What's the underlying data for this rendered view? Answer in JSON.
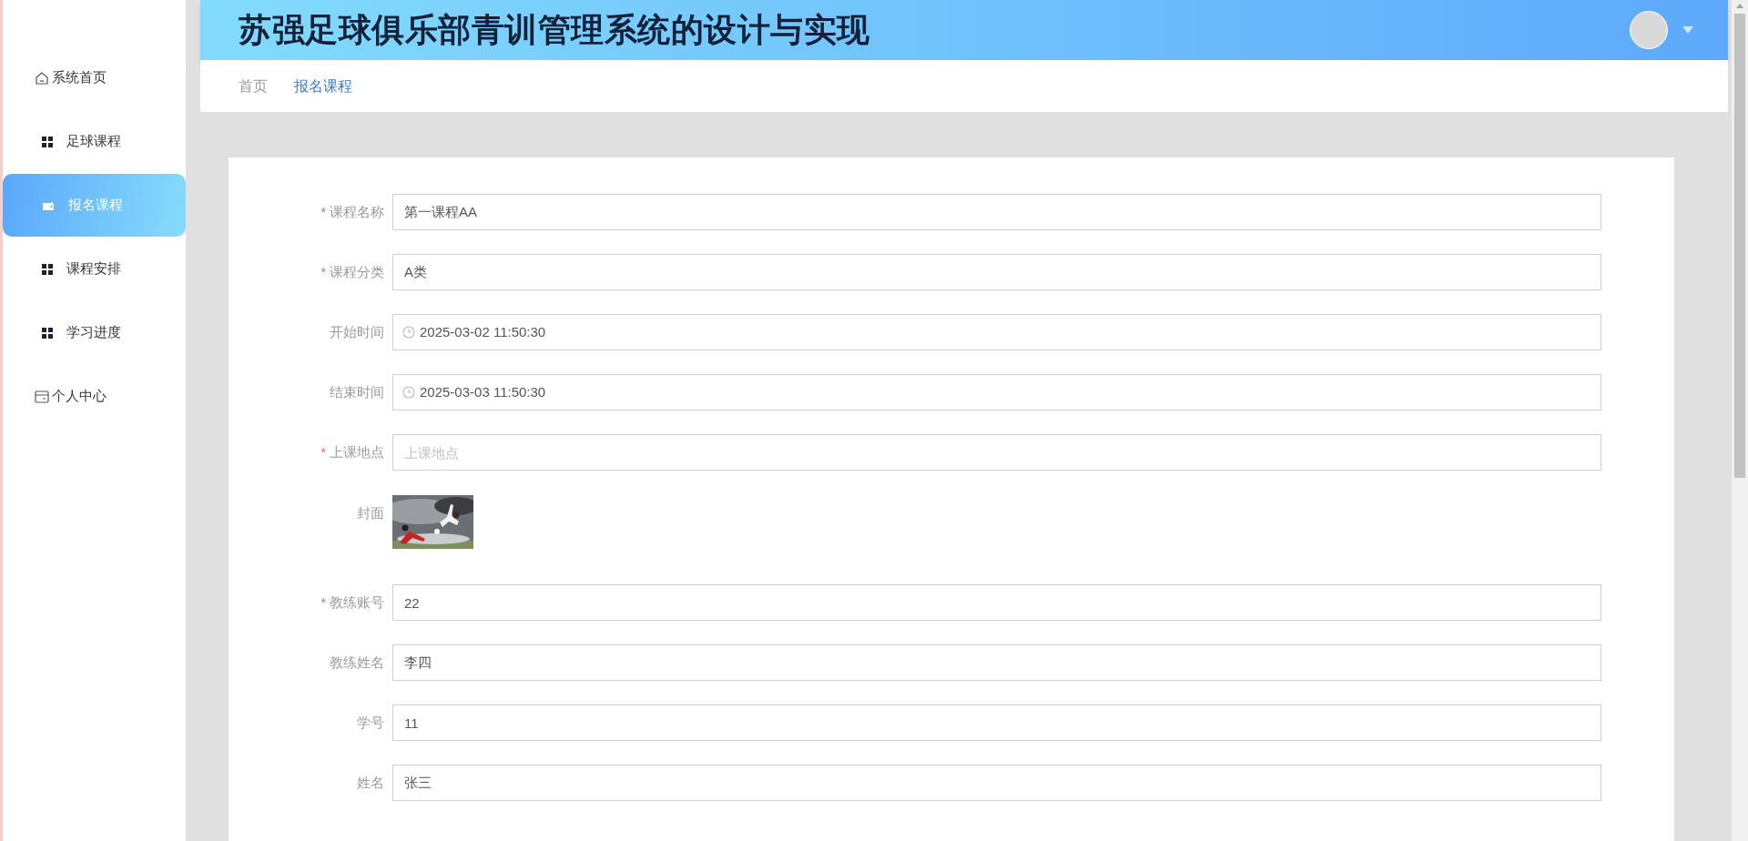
{
  "sidebar": {
    "items": [
      {
        "label": "系统首页",
        "kind": "home",
        "selected": false
      },
      {
        "label": "足球课程",
        "kind": "menu",
        "selected": false
      },
      {
        "label": "报名课程",
        "kind": "menu",
        "selected": true
      },
      {
        "label": "课程安排",
        "kind": "menu",
        "selected": false
      },
      {
        "label": "学习进度",
        "kind": "menu",
        "selected": false
      },
      {
        "label": "个人中心",
        "kind": "profile",
        "selected": false
      }
    ]
  },
  "header": {
    "title": "苏强足球俱乐部青训管理系统的设计与实现"
  },
  "breadcrumb": [
    {
      "label": "首页",
      "selected": false
    },
    {
      "label": "报名课程",
      "selected": true
    }
  ],
  "form": {
    "fields": [
      {
        "label": "课程名称",
        "required_mark": "*",
        "kind": "text",
        "value": "第一课程AA"
      },
      {
        "label": "课程分类",
        "required_mark": "*",
        "kind": "text",
        "value": "A类"
      },
      {
        "label": "开始时间",
        "kind": "datetime",
        "value": "2025-03-02 11:50:30"
      },
      {
        "label": "结束时间",
        "kind": "datetime",
        "value": "2025-03-03 11:50:30"
      },
      {
        "label": "上课地点",
        "required_mark": "*",
        "kind": "text",
        "placeholder": "上课地点"
      },
      {
        "label": "封面"
      },
      {
        "label": "教练账号",
        "required_mark": "*",
        "kind": "text",
        "value": "22"
      },
      {
        "label": "教练姓名",
        "kind": "text",
        "value": "李四"
      },
      {
        "label": "学号",
        "kind": "text",
        "value": "11"
      },
      {
        "label": "姓名",
        "kind": "text",
        "value": "张三"
      }
    ]
  }
}
